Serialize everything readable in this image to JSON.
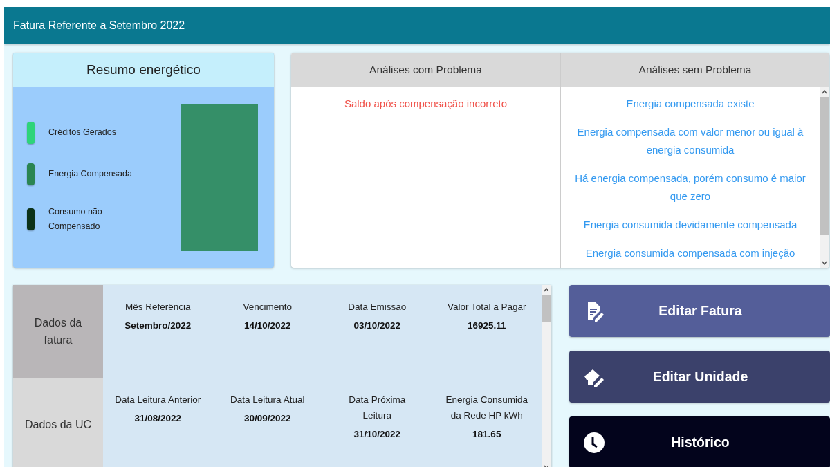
{
  "header": {
    "title": "Fatura Referente a Setembro 2022"
  },
  "summary": {
    "title": "Resumo energético",
    "legend": [
      {
        "label": "Créditos Gerados",
        "color": "#2ed47a"
      },
      {
        "label": "Energia Compensada",
        "color": "#2a8552"
      },
      {
        "label": "Consumo não Compensado",
        "color": "#0b3219"
      }
    ]
  },
  "analyses": {
    "columns": [
      {
        "title": "Análises com Problema",
        "kind": "problem",
        "items": [
          "Saldo após compensação incorreto"
        ]
      },
      {
        "title": "Análises sem Problema",
        "kind": "ok",
        "items": [
          "Energia compensada existe",
          "Energia compensada com valor menor ou igual à energia consumida",
          "Há energia compensada, porém consumo é maior que zero",
          "Energia consumida devidamente compensada",
          "Energia consumida compensada com injeção"
        ]
      }
    ]
  },
  "details": {
    "sections": [
      {
        "label": "Dados da fatura",
        "selected": true,
        "fields": [
          {
            "label": "Mês Referência",
            "value": "Setembro/2022"
          },
          {
            "label": "Vencimento",
            "value": "14/10/2022"
          },
          {
            "label": "Data Emissão",
            "value": "03/10/2022"
          },
          {
            "label": "Valor Total a Pagar",
            "value": "16925.11"
          }
        ]
      },
      {
        "label": "Dados da UC",
        "selected": false,
        "fields": [
          {
            "label": "Data Leitura Anterior",
            "value": "31/08/2022"
          },
          {
            "label": "Data Leitura Atual",
            "value": "30/09/2022"
          },
          {
            "label": "Data Próxima Leitura",
            "value": "31/10/2022"
          },
          {
            "label": "Energia Consumida da Rede HP kWh",
            "value": "181.65"
          }
        ]
      }
    ]
  },
  "actions": [
    {
      "label": "Editar Fatura",
      "kind": "invoice"
    },
    {
      "label": "Editar Unidade",
      "kind": "unit"
    },
    {
      "label": "Histórico",
      "kind": "history"
    }
  ]
}
